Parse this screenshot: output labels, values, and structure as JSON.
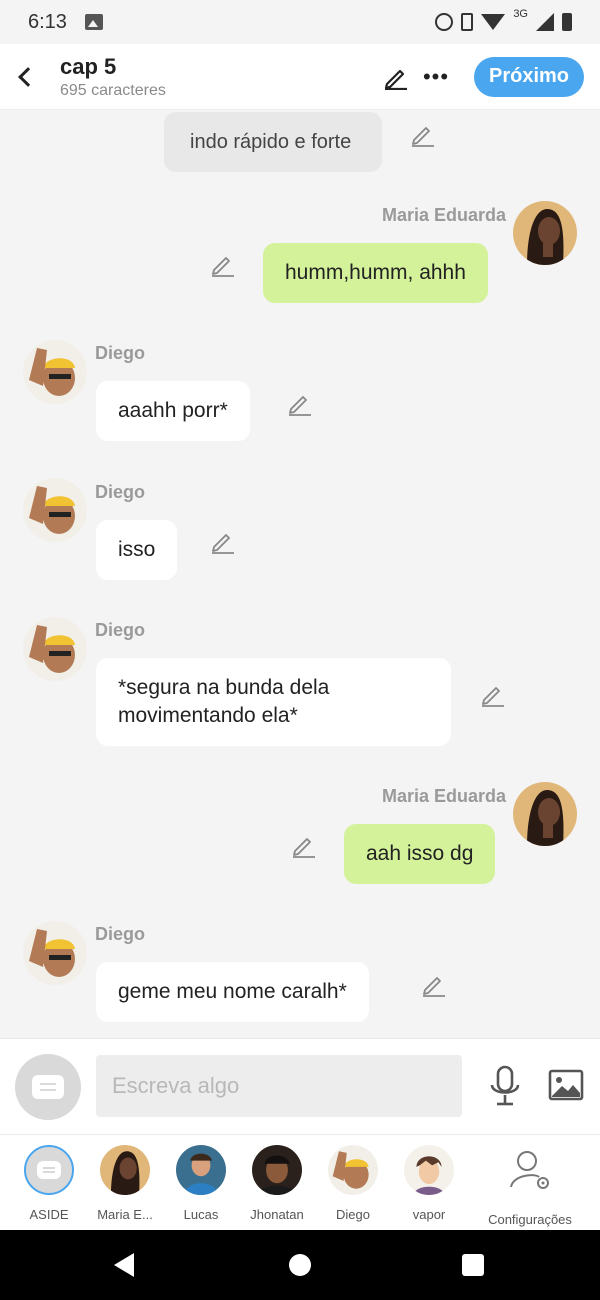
{
  "status": {
    "time": "6:13",
    "network": "3G"
  },
  "header": {
    "title": "cap 5",
    "subtitle": "695 caracteres",
    "next_label": "Próximo"
  },
  "messages": [
    {
      "type": "system",
      "text": "indo rápido e forte"
    },
    {
      "type": "outgoing",
      "sender": "Maria Eduarda",
      "text": "humm,humm, ahhh"
    },
    {
      "type": "incoming",
      "sender": "Diego",
      "text": "aaahh porr*"
    },
    {
      "type": "incoming",
      "sender": "Diego",
      "text": "isso"
    },
    {
      "type": "incoming",
      "sender": "Diego",
      "text_line1": "*segura na bunda dela",
      "text_line2": "movimentando ela*"
    },
    {
      "type": "outgoing",
      "sender": "Maria Eduarda",
      "text": "aah isso dg"
    },
    {
      "type": "incoming",
      "sender": "Diego",
      "text": "geme meu nome caralh*"
    }
  ],
  "composer": {
    "placeholder": "Escreva algo"
  },
  "characters": [
    {
      "name": "ASIDE"
    },
    {
      "name": "Maria E..."
    },
    {
      "name": "Lucas"
    },
    {
      "name": "Jhonatan"
    },
    {
      "name": "Diego"
    },
    {
      "name": "vapor"
    },
    {
      "name": "Configurações"
    }
  ],
  "colors": {
    "accent": "#4aa6ee",
    "outgoing_bubble": "#d3f29a",
    "incoming_bubble": "#ffffff",
    "system_bubble": "#e8e8e8",
    "chat_background": "#f4f4f4"
  },
  "icons": [
    "back-arrow-icon",
    "pencil-icon",
    "more-icon",
    "aside-icon",
    "microphone-icon",
    "image-icon",
    "settings-user-icon"
  ]
}
